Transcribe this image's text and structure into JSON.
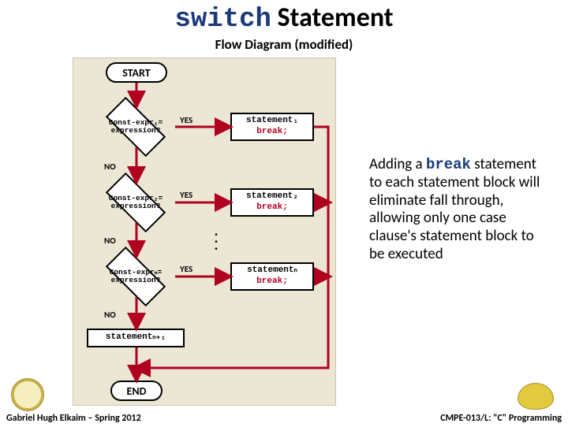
{
  "title_keyword": "switch",
  "title_rest": " Statement",
  "subtitle": "Flow Diagram (modified)",
  "start": "START",
  "end": "END",
  "yes": "YES",
  "no": "NO",
  "d1_a": "Const-expr₁=",
  "d1_b": "expression?",
  "d2_a": "Const-expr₂=",
  "d2_b": "expression?",
  "dn_a": "Const-exprₙ=",
  "dn_b": "expression?",
  "s1": "statement₁",
  "s2": "statement₂",
  "sn": "statementₙ",
  "snp1": "statementₙ₊₁",
  "brk": "break;",
  "explain_pre": "Adding a ",
  "explain_kw": "break",
  "explain_post": " statement to each statement block will eliminate fall through, allowing only one case clause's statement block to be executed",
  "footer_left": "Gabriel Hugh Elkaim – Spring 2012",
  "footer_right": "CMPE-013/L: \"C\" Programming"
}
